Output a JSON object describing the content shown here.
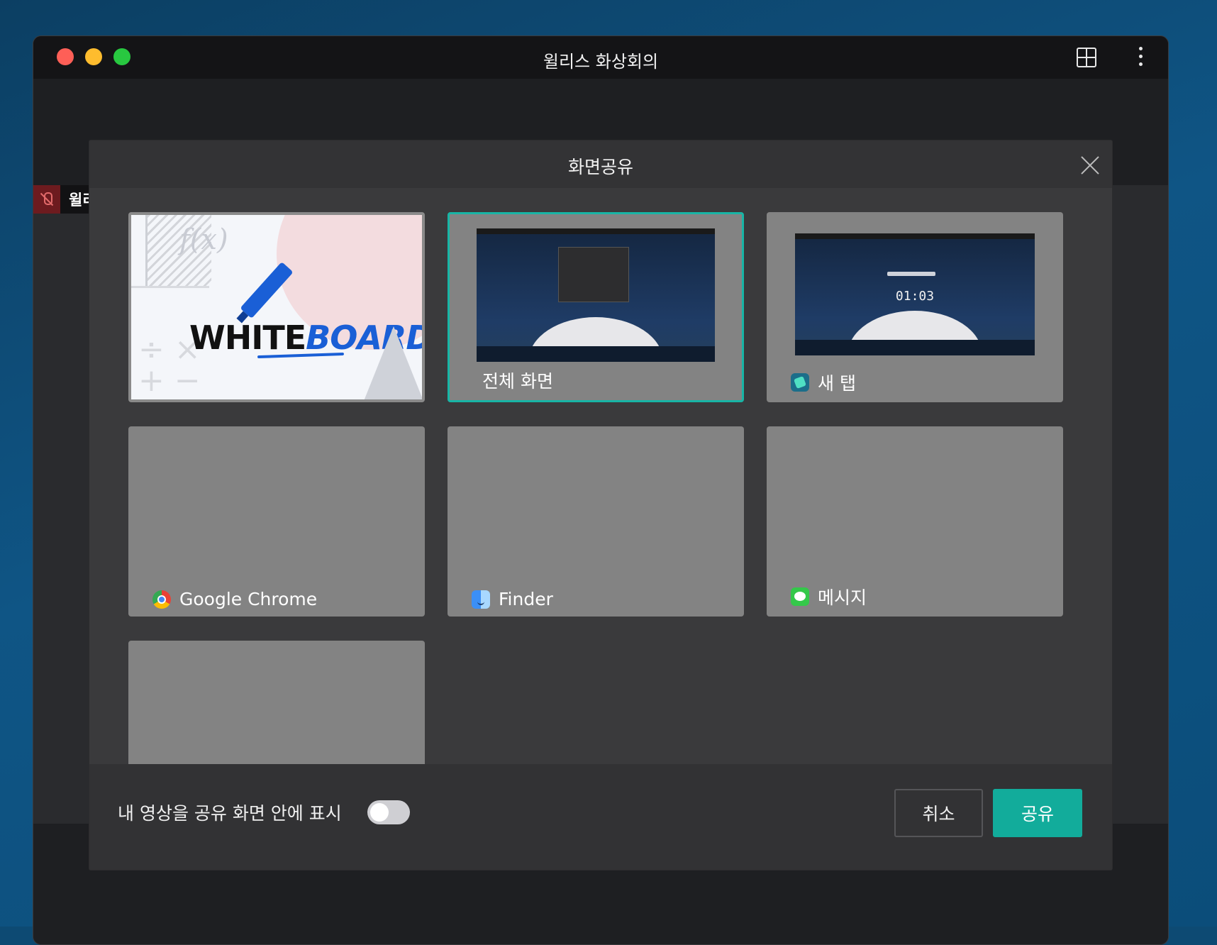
{
  "window": {
    "title": "윌리스 화상회의"
  },
  "participant": {
    "name_partial": "윌리"
  },
  "dialog": {
    "title": "화면공유",
    "tiles": [
      {
        "label": "",
        "kind": "whiteboard",
        "wb_fx": "f(x)",
        "wb_white": "WHITE",
        "wb_board": "BOARD",
        "wb_math": "÷ ×\n+ −"
      },
      {
        "label": "전체 화면",
        "kind": "screen",
        "selected": true
      },
      {
        "label": "새 탭",
        "kind": "tab",
        "icon": "newtab-icon",
        "clock": "01:03"
      },
      {
        "label": "Google Chrome",
        "kind": "app",
        "icon": "chrome-icon"
      },
      {
        "label": "Finder",
        "kind": "app",
        "icon": "finder-icon"
      },
      {
        "label": "메시지",
        "kind": "app",
        "icon": "messages-icon"
      },
      {
        "label": "",
        "kind": "app"
      }
    ],
    "footer": {
      "toggle_label": "내 영상을 공유 화면 안에 표시",
      "toggle_on": false,
      "cancel_label": "취소",
      "share_label": "공유"
    }
  },
  "colors": {
    "accent": "#12ac9b",
    "selected_border": "#18b5a6",
    "tile_bg": "#838383"
  }
}
